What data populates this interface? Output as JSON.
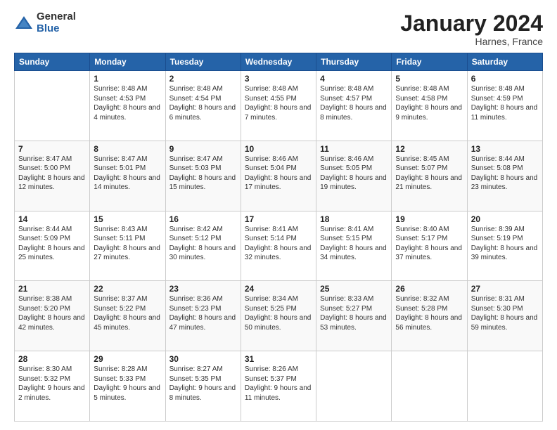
{
  "logo": {
    "general": "General",
    "blue": "Blue"
  },
  "header": {
    "month": "January 2024",
    "location": "Harnes, France"
  },
  "days_of_week": [
    "Sunday",
    "Monday",
    "Tuesday",
    "Wednesday",
    "Thursday",
    "Friday",
    "Saturday"
  ],
  "weeks": [
    [
      {
        "day": "",
        "sunrise": "",
        "sunset": "",
        "daylight": ""
      },
      {
        "day": "1",
        "sunrise": "Sunrise: 8:48 AM",
        "sunset": "Sunset: 4:53 PM",
        "daylight": "Daylight: 8 hours and 4 minutes."
      },
      {
        "day": "2",
        "sunrise": "Sunrise: 8:48 AM",
        "sunset": "Sunset: 4:54 PM",
        "daylight": "Daylight: 8 hours and 6 minutes."
      },
      {
        "day": "3",
        "sunrise": "Sunrise: 8:48 AM",
        "sunset": "Sunset: 4:55 PM",
        "daylight": "Daylight: 8 hours and 7 minutes."
      },
      {
        "day": "4",
        "sunrise": "Sunrise: 8:48 AM",
        "sunset": "Sunset: 4:57 PM",
        "daylight": "Daylight: 8 hours and 8 minutes."
      },
      {
        "day": "5",
        "sunrise": "Sunrise: 8:48 AM",
        "sunset": "Sunset: 4:58 PM",
        "daylight": "Daylight: 8 hours and 9 minutes."
      },
      {
        "day": "6",
        "sunrise": "Sunrise: 8:48 AM",
        "sunset": "Sunset: 4:59 PM",
        "daylight": "Daylight: 8 hours and 11 minutes."
      }
    ],
    [
      {
        "day": "7",
        "sunrise": "Sunrise: 8:47 AM",
        "sunset": "Sunset: 5:00 PM",
        "daylight": "Daylight: 8 hours and 12 minutes."
      },
      {
        "day": "8",
        "sunrise": "Sunrise: 8:47 AM",
        "sunset": "Sunset: 5:01 PM",
        "daylight": "Daylight: 8 hours and 14 minutes."
      },
      {
        "day": "9",
        "sunrise": "Sunrise: 8:47 AM",
        "sunset": "Sunset: 5:03 PM",
        "daylight": "Daylight: 8 hours and 15 minutes."
      },
      {
        "day": "10",
        "sunrise": "Sunrise: 8:46 AM",
        "sunset": "Sunset: 5:04 PM",
        "daylight": "Daylight: 8 hours and 17 minutes."
      },
      {
        "day": "11",
        "sunrise": "Sunrise: 8:46 AM",
        "sunset": "Sunset: 5:05 PM",
        "daylight": "Daylight: 8 hours and 19 minutes."
      },
      {
        "day": "12",
        "sunrise": "Sunrise: 8:45 AM",
        "sunset": "Sunset: 5:07 PM",
        "daylight": "Daylight: 8 hours and 21 minutes."
      },
      {
        "day": "13",
        "sunrise": "Sunrise: 8:44 AM",
        "sunset": "Sunset: 5:08 PM",
        "daylight": "Daylight: 8 hours and 23 minutes."
      }
    ],
    [
      {
        "day": "14",
        "sunrise": "Sunrise: 8:44 AM",
        "sunset": "Sunset: 5:09 PM",
        "daylight": "Daylight: 8 hours and 25 minutes."
      },
      {
        "day": "15",
        "sunrise": "Sunrise: 8:43 AM",
        "sunset": "Sunset: 5:11 PM",
        "daylight": "Daylight: 8 hours and 27 minutes."
      },
      {
        "day": "16",
        "sunrise": "Sunrise: 8:42 AM",
        "sunset": "Sunset: 5:12 PM",
        "daylight": "Daylight: 8 hours and 30 minutes."
      },
      {
        "day": "17",
        "sunrise": "Sunrise: 8:41 AM",
        "sunset": "Sunset: 5:14 PM",
        "daylight": "Daylight: 8 hours and 32 minutes."
      },
      {
        "day": "18",
        "sunrise": "Sunrise: 8:41 AM",
        "sunset": "Sunset: 5:15 PM",
        "daylight": "Daylight: 8 hours and 34 minutes."
      },
      {
        "day": "19",
        "sunrise": "Sunrise: 8:40 AM",
        "sunset": "Sunset: 5:17 PM",
        "daylight": "Daylight: 8 hours and 37 minutes."
      },
      {
        "day": "20",
        "sunrise": "Sunrise: 8:39 AM",
        "sunset": "Sunset: 5:19 PM",
        "daylight": "Daylight: 8 hours and 39 minutes."
      }
    ],
    [
      {
        "day": "21",
        "sunrise": "Sunrise: 8:38 AM",
        "sunset": "Sunset: 5:20 PM",
        "daylight": "Daylight: 8 hours and 42 minutes."
      },
      {
        "day": "22",
        "sunrise": "Sunrise: 8:37 AM",
        "sunset": "Sunset: 5:22 PM",
        "daylight": "Daylight: 8 hours and 45 minutes."
      },
      {
        "day": "23",
        "sunrise": "Sunrise: 8:36 AM",
        "sunset": "Sunset: 5:23 PM",
        "daylight": "Daylight: 8 hours and 47 minutes."
      },
      {
        "day": "24",
        "sunrise": "Sunrise: 8:34 AM",
        "sunset": "Sunset: 5:25 PM",
        "daylight": "Daylight: 8 hours and 50 minutes."
      },
      {
        "day": "25",
        "sunrise": "Sunrise: 8:33 AM",
        "sunset": "Sunset: 5:27 PM",
        "daylight": "Daylight: 8 hours and 53 minutes."
      },
      {
        "day": "26",
        "sunrise": "Sunrise: 8:32 AM",
        "sunset": "Sunset: 5:28 PM",
        "daylight": "Daylight: 8 hours and 56 minutes."
      },
      {
        "day": "27",
        "sunrise": "Sunrise: 8:31 AM",
        "sunset": "Sunset: 5:30 PM",
        "daylight": "Daylight: 8 hours and 59 minutes."
      }
    ],
    [
      {
        "day": "28",
        "sunrise": "Sunrise: 8:30 AM",
        "sunset": "Sunset: 5:32 PM",
        "daylight": "Daylight: 9 hours and 2 minutes."
      },
      {
        "day": "29",
        "sunrise": "Sunrise: 8:28 AM",
        "sunset": "Sunset: 5:33 PM",
        "daylight": "Daylight: 9 hours and 5 minutes."
      },
      {
        "day": "30",
        "sunrise": "Sunrise: 8:27 AM",
        "sunset": "Sunset: 5:35 PM",
        "daylight": "Daylight: 9 hours and 8 minutes."
      },
      {
        "day": "31",
        "sunrise": "Sunrise: 8:26 AM",
        "sunset": "Sunset: 5:37 PM",
        "daylight": "Daylight: 9 hours and 11 minutes."
      },
      {
        "day": "",
        "sunrise": "",
        "sunset": "",
        "daylight": ""
      },
      {
        "day": "",
        "sunrise": "",
        "sunset": "",
        "daylight": ""
      },
      {
        "day": "",
        "sunrise": "",
        "sunset": "",
        "daylight": ""
      }
    ]
  ]
}
